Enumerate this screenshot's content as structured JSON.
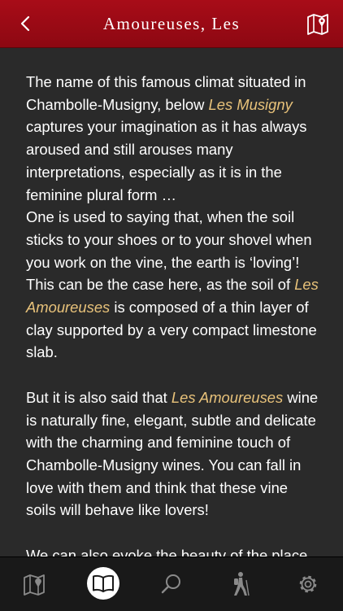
{
  "header": {
    "title": "Amoureuses, Les",
    "back_icon": "chevron-left-icon",
    "map_icon": "map-pin-icon"
  },
  "article": {
    "p1": {
      "before": "The name of this famous climat situated in Chambolle-Musigny, below ",
      "link": "Les Musigny",
      "after": " captures your imagination as it has always aroused and still arouses many interpretations, especially as it is in the feminine plural form …"
    },
    "p2": {
      "before": "One is used to saying that, when the soil sticks to your shoes or to your shovel when you work on the vine, the earth is ‘loving’! This can be the case here, as the soil of ",
      "link": "Les Amoureuses",
      "after": " is composed of a thin layer of clay supported by a very compact limestone slab."
    },
    "p3": {
      "before": "But it is also said that ",
      "link": "Les Amoureuses",
      "after": " wine is naturally fine, elegant, subtle and delicate with the charming and feminine touch of Chambolle-Musigny wines. You can fall in love with them and think that these vine soils will behave like lovers!"
    },
    "p4": {
      "text": "We can also evoke the beauty of the place"
    }
  },
  "tabbar": {
    "tabs": [
      {
        "icon": "map-icon",
        "active": false
      },
      {
        "icon": "book-icon",
        "active": true
      },
      {
        "icon": "search-icon",
        "active": false
      },
      {
        "icon": "hiker-icon",
        "active": false
      },
      {
        "icon": "gear-icon",
        "active": false
      }
    ]
  },
  "colors": {
    "header_red": "#a80c18",
    "background": "#2a2a2a",
    "highlight": "#e8c27a",
    "tabbar": "#191919"
  }
}
